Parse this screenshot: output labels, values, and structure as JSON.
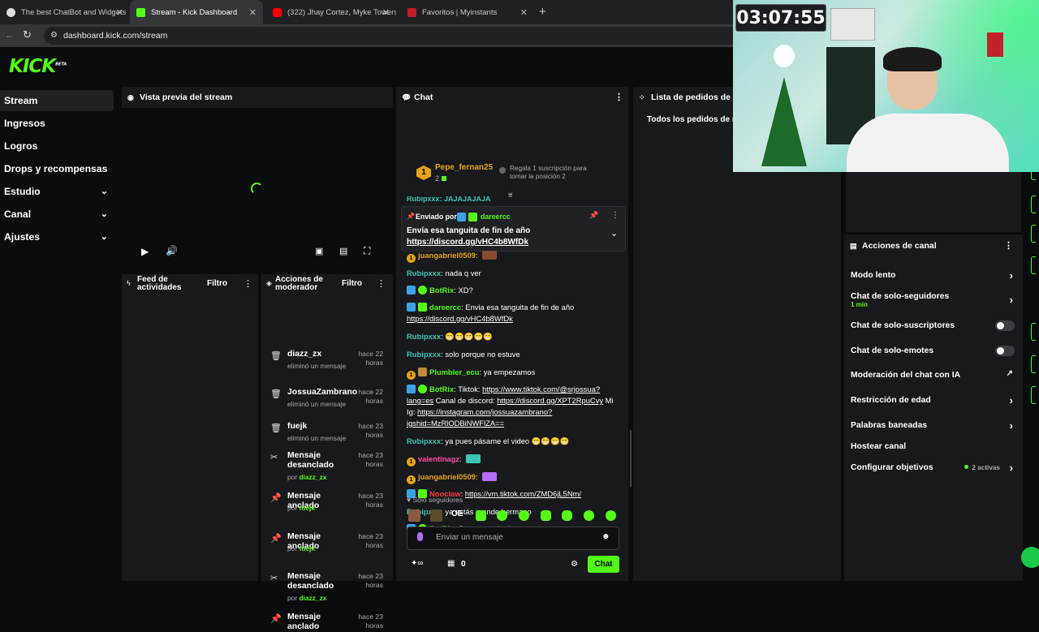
{
  "browser": {
    "tabs": [
      {
        "title": "The best ChatBot and Widgets",
        "active": false
      },
      {
        "title": "Stream - Kick Dashboard",
        "active": true
      },
      {
        "title": "(322) Jhay Cortez, Myke Towers",
        "active": false
      },
      {
        "title": "Favoritos | Myinstants",
        "active": false
      }
    ],
    "url": "dashboard.kick.com/stream"
  },
  "sidebar": {
    "logo": "KICK",
    "logo_tag": "BETA",
    "items": [
      {
        "label": "Stream",
        "selected": true,
        "expandable": false
      },
      {
        "label": "Ingresos",
        "selected": false,
        "expandable": false
      },
      {
        "label": "Logros",
        "selected": false,
        "expandable": false
      },
      {
        "label": "Drops y recompensas",
        "selected": false,
        "expandable": false
      },
      {
        "label": "Estudio",
        "selected": false,
        "expandable": true
      },
      {
        "label": "Canal",
        "selected": false,
        "expandable": true
      },
      {
        "label": "Ajustes",
        "selected": false,
        "expandable": true
      }
    ]
  },
  "preview": {
    "title": "Vista previa del stream"
  },
  "feed": {
    "title_line1": "Feed de",
    "title_line2": "actividades",
    "filter": "Filtro"
  },
  "mod": {
    "title_line1": "Acciones de",
    "title_line2": "moderador",
    "filter": "Filtro",
    "items": [
      {
        "icon": "trash-icon",
        "title": "diazz_zx",
        "sub": "eliminó un mensaje",
        "by": "",
        "time": "hace 22 horas"
      },
      {
        "icon": "trash-icon",
        "title": "JossuaZambrano",
        "sub": "eliminó un mensaje",
        "by": "",
        "time": "hace 22 horas"
      },
      {
        "icon": "trash-icon",
        "title": "fuejk",
        "sub": "eliminó un mensaje",
        "by": "",
        "time": "hace 23 horas"
      },
      {
        "icon": "unpin-icon",
        "title": "Mensaje desanclado",
        "sub": "por ",
        "by": "diazz_zx",
        "time": "hace 23 horas"
      },
      {
        "icon": "pin-icon",
        "title": "Mensaje anclado",
        "sub": "por ",
        "by": "fuejk",
        "time": "hace 23 horas"
      },
      {
        "icon": "pin-icon",
        "title": "Mensaje anclado",
        "sub": "por ",
        "by": "fuejk",
        "time": "hace 23 horas"
      },
      {
        "icon": "unpin-icon",
        "title": "Mensaje desanclado",
        "sub": "por ",
        "by": "diazz_zx",
        "time": "hace 23 horas"
      },
      {
        "icon": "pin-icon",
        "title": "Mensaje anclado",
        "sub": "",
        "by": "",
        "time": "hace 23 horas"
      }
    ]
  },
  "chat": {
    "title": "Chat",
    "top_gifter": {
      "rank": "1",
      "name": "Pepe_fernan25",
      "count": "2",
      "promo": "Regala 1 suscripción para tomar la posición 2"
    },
    "cut_top": "Rubipxxx: JAJAJAJAJA",
    "pinned": {
      "by_label": "Enviado por",
      "by_user": "dareercc",
      "text": "Envía esa tanguita de fin de año",
      "link": "https://discord.gg/vHC4b8WfDk"
    },
    "messages": [
      {
        "user": "juangabriel0509",
        "color": "#e5a319",
        "sep": ":",
        "text": "",
        "link": ""
      },
      {
        "user": "Rubipxxx",
        "color": "#3ec4b2",
        "sep": ":",
        "text": "nada q ver",
        "link": ""
      },
      {
        "user": "BotRix",
        "color": "#53fc18",
        "sep": ":",
        "text": "XD?",
        "link": ""
      },
      {
        "user": "dareercc",
        "color": "#53fc18",
        "sep": ":",
        "text": "Envia esa tanguita de fin de año",
        "link": "https://discord.gg/vHC4b8WfDk"
      },
      {
        "user": "Rubipxxx",
        "color": "#3ec4b2",
        "sep": ":",
        "text": "😁😁😁😁😁",
        "link": ""
      },
      {
        "user": "Rubipxxx",
        "color": "#3ec4b2",
        "sep": ":",
        "text": "solo porque no estuve",
        "link": ""
      },
      {
        "user": "Plumbler_ecu",
        "color": "#53fc18",
        "sep": ":",
        "text": "ya empezamos",
        "link": ""
      },
      {
        "user": "BotRix",
        "color": "#53fc18",
        "sep": ":",
        "text": "Tiktok: ",
        "link": "https://www.tiktok.com/@srjossua?lang=es",
        "text2": " Canal de discord: ",
        "link2": "https://discord.gg/XPT2RpuCvy",
        "text3": " Mi Ig: ",
        "link3": "https://instagram.com/jossuazambrano?igshid=MzRlODBiNWFlZA=="
      },
      {
        "user": "Rubipxxx",
        "color": "#3ec4b2",
        "sep": ":",
        "text": "ya pues pásame el video 😁😁😁😁",
        "link": ""
      },
      {
        "user": "valentinagz",
        "color": "#ff4fa3",
        "sep": ":",
        "text": "",
        "link": ""
      },
      {
        "user": "juangabriel0509",
        "color": "#e5a319",
        "sep": ":",
        "text": "",
        "link": ""
      },
      {
        "user": "Nooclaw",
        "color": "#ff3b3b",
        "sep": ":",
        "text": "",
        "link": "https://vm.tiktok.com/ZMD6jL5Nm/"
      },
      {
        "user": "Rubipxxx",
        "color": "#3ec4b2",
        "sep": ":",
        "text": "ya estás grande hermano",
        "link": ""
      },
      {
        "user": "BotRix",
        "color": "#53fc18",
        "sep": ":",
        "text": "Como tonto! xd",
        "link": ""
      }
    ],
    "followers_only": "Solo seguidores",
    "placeholder": "Enviar un mensaje",
    "viewers": "0",
    "send": "Chat"
  },
  "requests": {
    "title": "Lista de pedidos de R",
    "tab": "Todos los pedidos de r"
  },
  "channel_actions": {
    "title": "Acciones de canal",
    "items": [
      {
        "label": "Modo lento",
        "kind": "arrow",
        "sub": ""
      },
      {
        "label": "Chat de solo-seguidores",
        "kind": "arrow",
        "sub": "1 min"
      },
      {
        "label": "Chat de solo-suscriptores",
        "kind": "toggle",
        "sub": ""
      },
      {
        "label": "Chat de solo-emotes",
        "kind": "toggle",
        "sub": ""
      },
      {
        "label": "Moderación del chat con IA",
        "kind": "external",
        "sub": ""
      },
      {
        "label": "Restricción de edad",
        "kind": "arrow",
        "sub": ""
      },
      {
        "label": "Palabras baneadas",
        "kind": "arrow",
        "sub": ""
      },
      {
        "label": "Hostear canal",
        "kind": "none",
        "sub": ""
      },
      {
        "label": "Configurar objetivos",
        "kind": "arrow",
        "sub": "2 activas"
      }
    ]
  },
  "webcam": {
    "timer": "03:07:55"
  },
  "colors": {
    "accent": "#53fc18",
    "panel": "#18191c",
    "background": "#0b0c0d"
  }
}
